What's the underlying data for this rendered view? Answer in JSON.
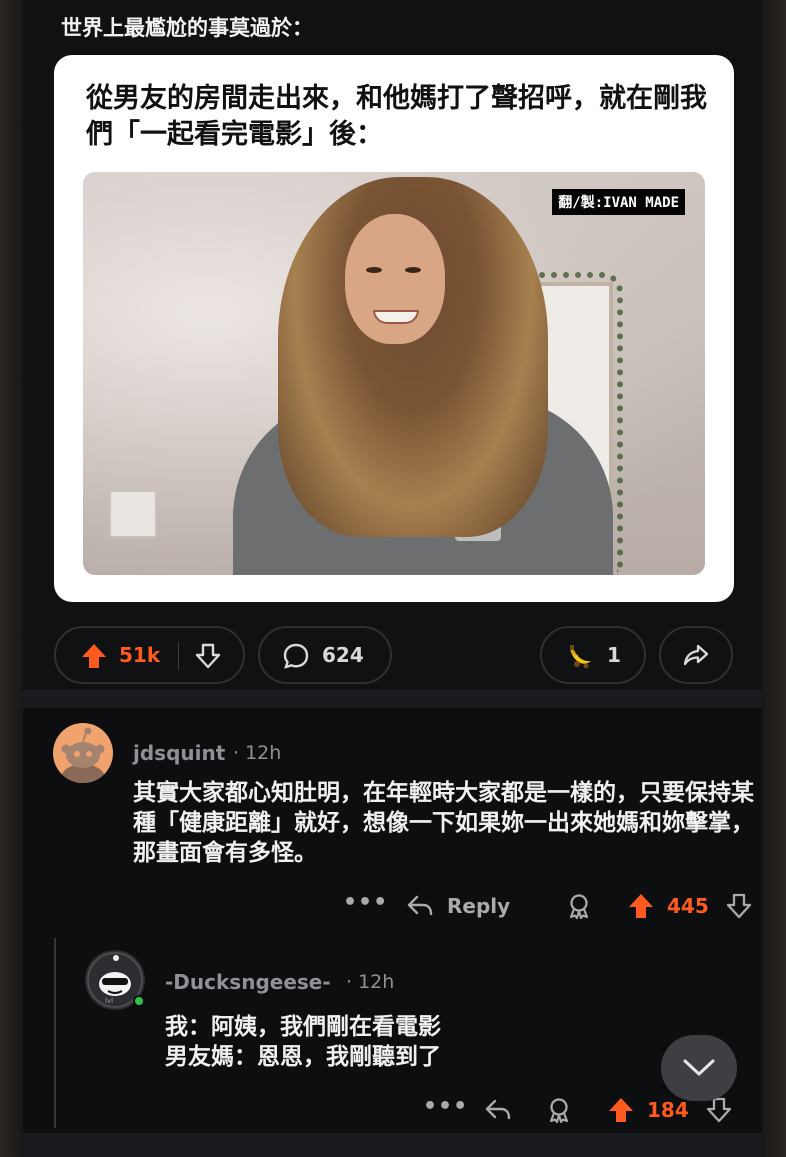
{
  "post": {
    "title": "世界上最尷尬的事莫過於：",
    "meme_caption": "從男友的房間走出來，和他媽打了聲招呼，就在剛我們「一起看完電影」後：",
    "watermark": "翻/製:IVAN MADE",
    "upvotes": "51k",
    "comments": "624",
    "awards": "1"
  },
  "comments": [
    {
      "username": "jdsquint",
      "time": "· 12h",
      "body": "其實大家都心知肚明，在年輕時大家都是一樣的，只要保持某種「健康距離」就好，想像一下如果妳一出來她媽和妳擊掌，那畫面會有多怪。",
      "more": "•••",
      "reply_label": "Reply",
      "score": "445"
    },
    {
      "username": "-Ducksngeese-",
      "time": "· 12h",
      "body_line1": "我：阿姨，我們剛在看電影",
      "body_line2": "男友媽：恩恩，我剛聽到了",
      "more": "•••",
      "score": "184"
    }
  ],
  "colors": {
    "upvote": "#ff5a1f",
    "background": "#0d0e10",
    "text": "#d7dadc"
  }
}
